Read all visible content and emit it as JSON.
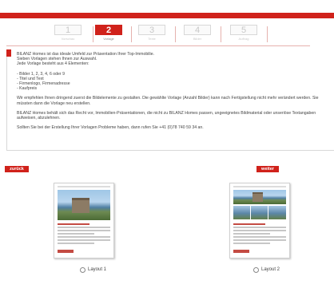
{
  "colors": {
    "accent": "#d0221b"
  },
  "stepper": {
    "steps": [
      {
        "number": "1",
        "label": "Vorschau",
        "active": false
      },
      {
        "number": "2",
        "label": "Vorlage",
        "active": true
      },
      {
        "number": "3",
        "label": "Texte",
        "active": false
      },
      {
        "number": "4",
        "label": "Bilder",
        "active": false
      },
      {
        "number": "5",
        "label": "Auftrag",
        "active": false
      }
    ]
  },
  "intro": {
    "paragraphs": [
      "BILANZ Homes ist das ideale Umfeld zur Präsentation Ihrer Top-Immobilie.",
      "Sieben Vorlagen stehen Ihnen zur Auswahl.",
      "Jede Vorlage besteht aus 4 Elementen:",
      "- Bilder 1, 2, 3, 4, 6 oder 9",
      "- Titel und Text",
      "- Firmenlogo, Firmenadresse",
      "- Kaufpreis",
      "Wir empfehlen Ihnen dringend zuerst die Bildelemente zu gestalten. Die gewählte Vorlage (Anzahl Bilder) kann nach Fertigstellung nicht mehr verändert werden. Sie müssten dann die Vorlage neu erstellen.",
      "BILANZ Homes behält sich das Recht vor, Immobilien-Präsentationen, die nicht zu BILANZ Homes passen, ungeeignetes Bildmaterial oder unseriöse Textangaben aufweisen, abzulehnen.",
      "Sollten Sie bei der Erstellung Ihrer Vorlagen Probleme haben, dann rufen Sie +41 (0)78 740 59 34 an."
    ]
  },
  "nav": {
    "back_label": "zurück",
    "next_label": "weiter"
  },
  "layouts": [
    {
      "label": "Layout 1",
      "selected": false
    },
    {
      "label": "Layout 2",
      "selected": false
    }
  ]
}
